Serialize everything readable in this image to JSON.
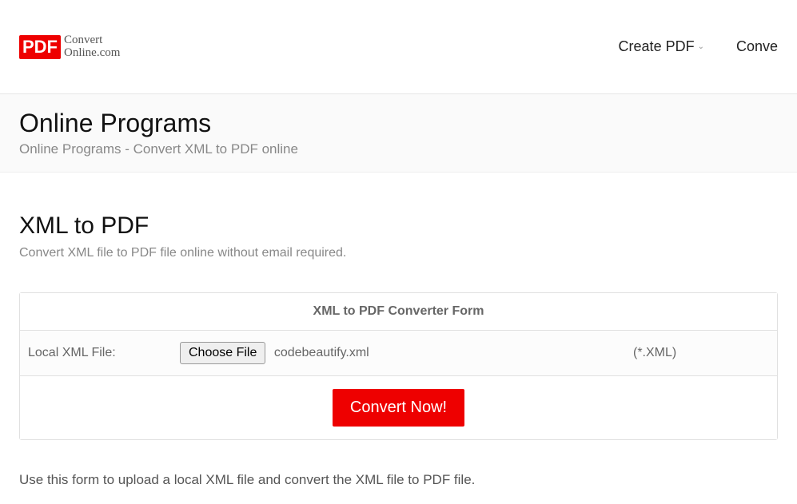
{
  "logo": {
    "badge": "PDF",
    "line1": "Convert",
    "line2": "Online.com"
  },
  "nav": {
    "create_label": "Create PDF",
    "convert_label": "Conve"
  },
  "titleSection": {
    "title": "Online Programs",
    "subtitle": "Online Programs - Convert XML to PDF online"
  },
  "section": {
    "title": "XML to PDF",
    "desc": "Convert XML file to PDF file online without email required."
  },
  "form": {
    "header": "XML to PDF Converter Form",
    "label": "Local XML File:",
    "choose_button": "Choose File",
    "filename": "codebeautify.xml",
    "extension_hint": "(*.XML)",
    "submit": "Convert Now!"
  },
  "footer": {
    "text": "Use this form to upload a local XML file and convert the XML file to PDF file."
  }
}
